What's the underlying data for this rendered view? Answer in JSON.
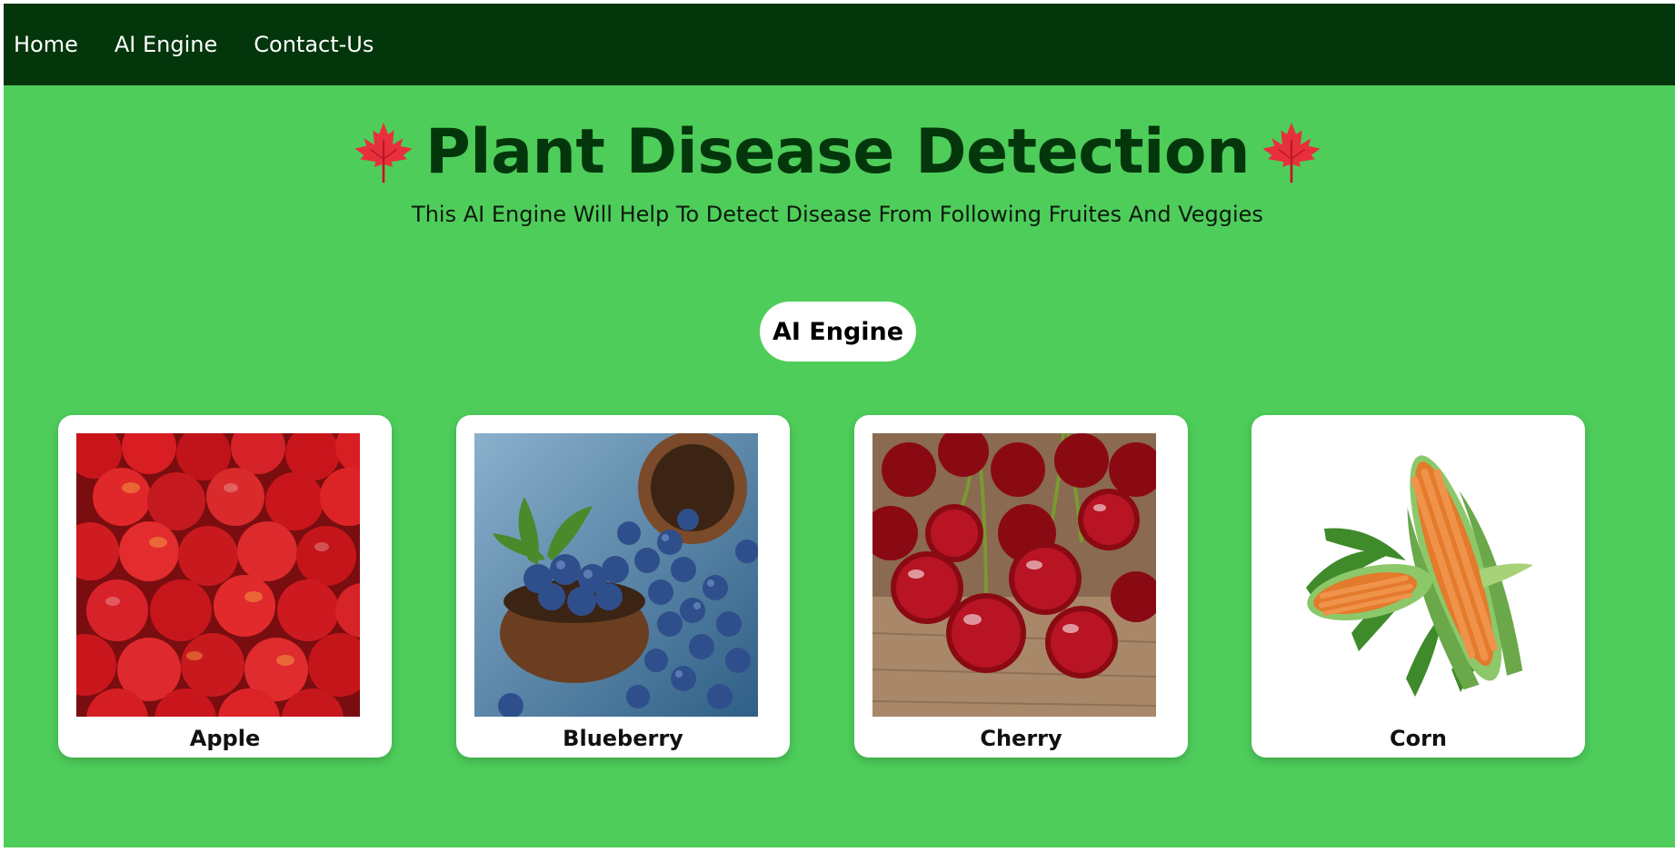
{
  "nav": {
    "items": [
      {
        "label": "Home"
      },
      {
        "label": "AI Engine"
      },
      {
        "label": "Contact-Us"
      }
    ]
  },
  "hero": {
    "title": "Plant Disease Detection",
    "subtitle": "This AI Engine Will Help To Detect Disease From Following Fruites And Veggies",
    "icon": "maple-leaf-icon"
  },
  "cta": {
    "label": "AI Engine"
  },
  "cards": [
    {
      "label": "Apple",
      "image": "apple-photo"
    },
    {
      "label": "Blueberry",
      "image": "blueberry-photo"
    },
    {
      "label": "Cherry",
      "image": "cherry-photo"
    },
    {
      "label": "Corn",
      "image": "corn-photo"
    }
  ],
  "colors": {
    "nav_bg": "#04360b",
    "page_bg": "#4ecd5b",
    "title": "#04360b",
    "leaf": "#e8303c"
  }
}
